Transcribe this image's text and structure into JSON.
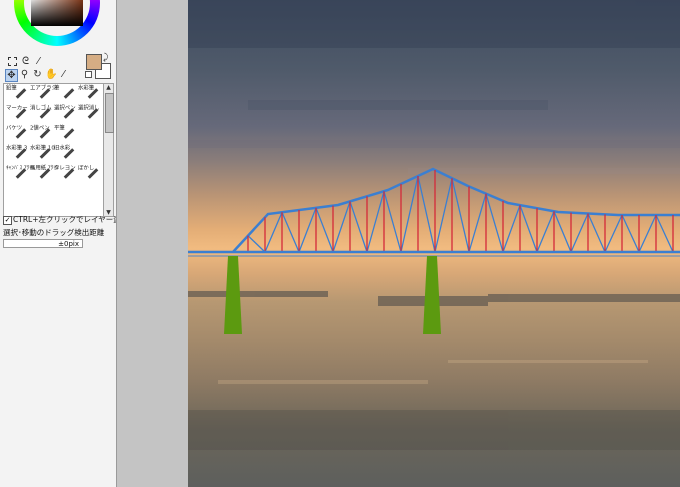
{
  "tools": {
    "row1": [
      "marquee-select-icon",
      "lasso-select-icon",
      "magic-wand-icon"
    ],
    "row2": [
      "move-icon",
      "zoom-icon",
      "rotate-icon",
      "hand-icon",
      "eyedropper-icon"
    ]
  },
  "colors": {
    "main": "#d5ad84",
    "sub": "#ffffff"
  },
  "brushes": [
    {
      "label": "鉛筆"
    },
    {
      "label": "エアブラシ"
    },
    {
      "label": "筆"
    },
    {
      "label": "水彩筆"
    },
    {
      "label": "マーカー"
    },
    {
      "label": "消しゴム"
    },
    {
      "label": "選択ペン"
    },
    {
      "label": "選択消し"
    },
    {
      "label": "バケツ"
    },
    {
      "label": "2値ペン"
    },
    {
      "label": "平筆"
    },
    {
      "label": ""
    },
    {
      "label": "水彩筆 3"
    },
    {
      "label": "水彩筆 10"
    },
    {
      "label": "旧水彩"
    },
    {
      "label": ""
    },
    {
      "label": "ｷｬﾝﾊﾞｽ ｱｸﾘﾙ"
    },
    {
      "label": "画用紙 ｱｸﾘﾙ"
    },
    {
      "label": "クレヨン"
    },
    {
      "label": "ぼかし"
    }
  ],
  "options": {
    "ctrl_check": "✓",
    "ctrl_label": "CTRL+左クリックでレイヤー選択",
    "drag_label": "選択･移動のドラッグ検出距離",
    "drag_value": "±0pix"
  },
  "bridge": {
    "truss_color": "#3b7fd1",
    "vertical_color": "#d42a3a",
    "pier_color": "#5c9a10"
  }
}
